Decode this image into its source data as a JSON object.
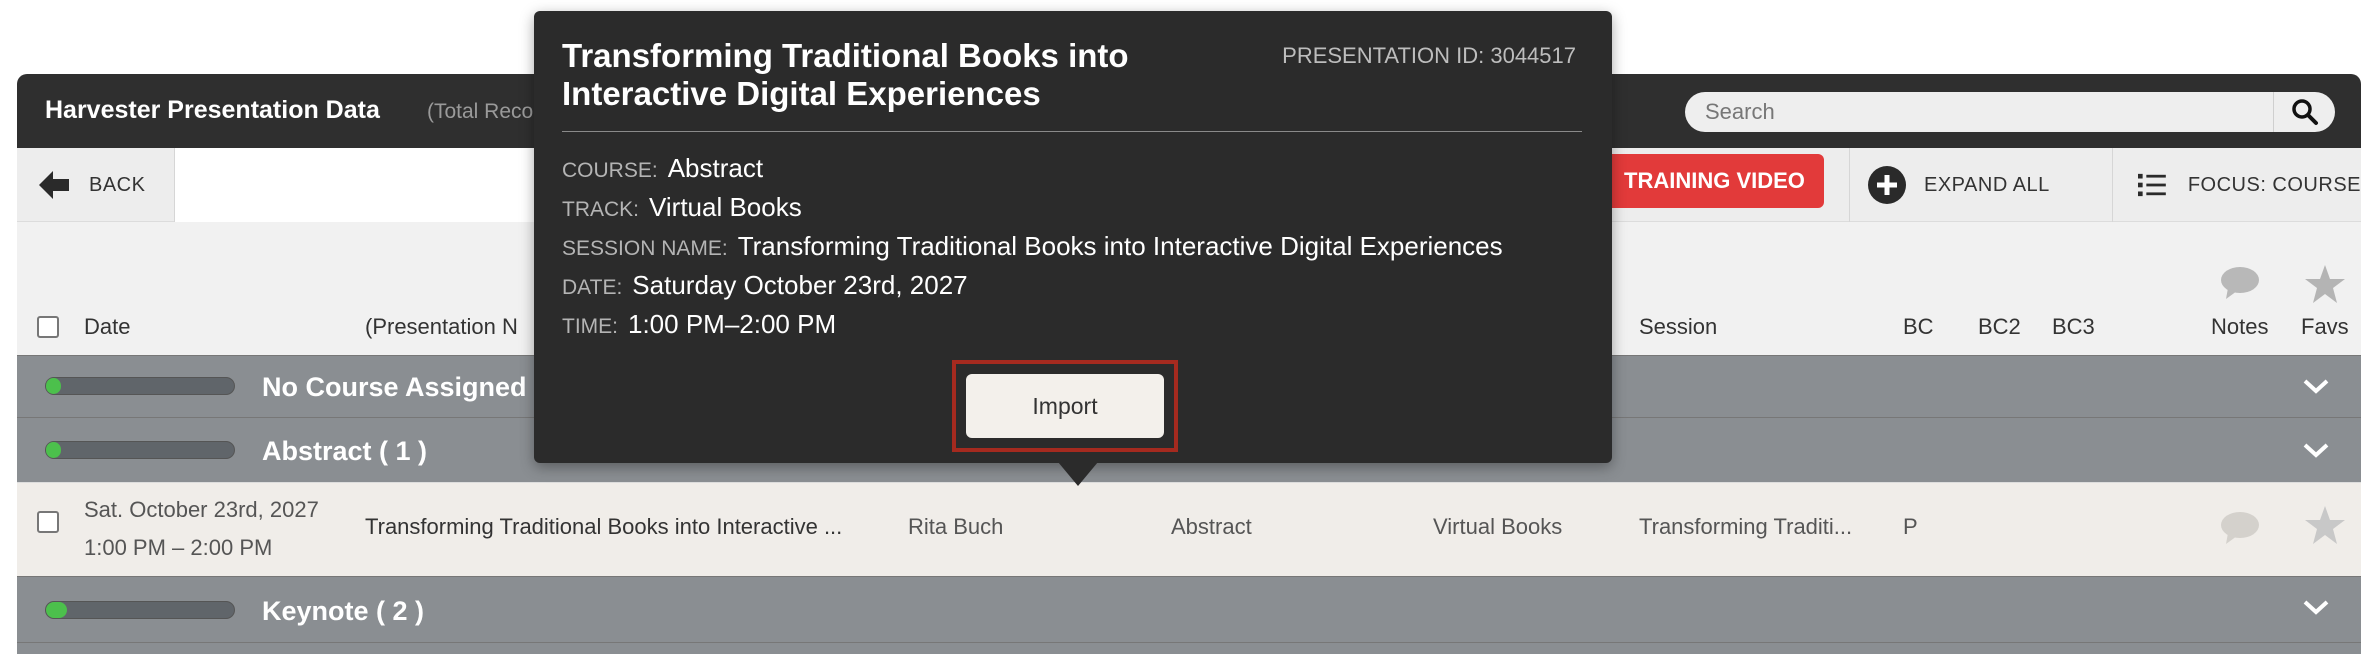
{
  "header": {
    "title": "Harvester Presentation Data",
    "subtitle": "(Total Reco",
    "search_placeholder": "Search"
  },
  "toolbar": {
    "back_label": "BACK",
    "training_label": "TRAINING VIDEO",
    "expand_label": "EXPAND ALL",
    "focus_label": "FOCUS: COURSE"
  },
  "columns": {
    "date": "Date",
    "presentation": "(Presentation N",
    "session": "Session",
    "bc": "BC",
    "bc2": "BC2",
    "bc3": "BC3",
    "notes": "Notes",
    "favs": "Favs"
  },
  "groups": [
    {
      "label": "No Course Assigned",
      "progress": 0.05
    },
    {
      "label": "Abstract   ( 1 )",
      "progress": 0.05
    },
    {
      "label": "Keynote   ( 2 )",
      "progress": 0.11
    }
  ],
  "row": {
    "date_line1": "Sat. October 23rd, 2027",
    "date_line2": "1:00 PM – 2:00 PM",
    "presentation": "Transforming Traditional Books into Interactive ...",
    "presenter": "Rita Buch",
    "course": "Abstract",
    "track": "Virtual Books",
    "session": "Transforming Traditi...",
    "bc": "P"
  },
  "popup": {
    "title": "Transforming Traditional Books into Interactive Digital Experiences",
    "presentation_id": "PRESENTATION ID: 3044517",
    "course_label": "COURSE:",
    "course_value": "Abstract",
    "track_label": "TRACK:",
    "track_value": "Virtual Books",
    "session_label": "SESSION NAME:",
    "session_value": "Transforming Traditional Books into Interactive Digital Experiences",
    "date_label": "DATE:",
    "date_value": "Saturday October 23rd, 2027",
    "time_label": "TIME:",
    "time_value": "1:00 PM–2:00 PM",
    "import_label": "Import"
  },
  "colors": {
    "header_bg": "#2f2f2f",
    "training_red": "#e23a3a",
    "group_bg": "#8a8e92",
    "progress_green": "#4cc04c",
    "import_highlight": "#a52a1f"
  }
}
